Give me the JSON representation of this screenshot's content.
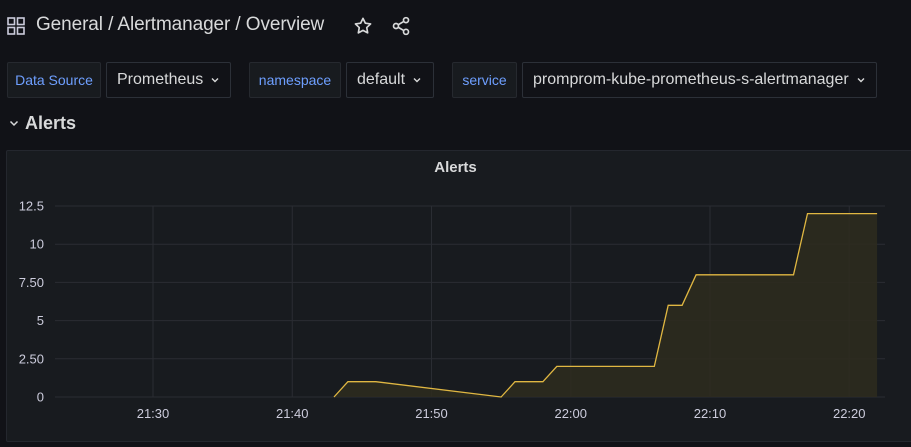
{
  "header": {
    "breadcrumb": "General  / Alertmanager / Overview"
  },
  "icons": {
    "apps": "apps-grid-icon",
    "star": "star-icon",
    "share": "share-icon",
    "chevron": "chevron-down-icon"
  },
  "variables": [
    {
      "label": "Data Source",
      "value": "Prometheus"
    },
    {
      "label": "namespace",
      "value": "default"
    },
    {
      "label": "service",
      "value": "promprom-kube-prometheus-s-alertmanager"
    }
  ],
  "row": {
    "title": "Alerts"
  },
  "panel": {
    "title": "Alerts"
  },
  "colors": {
    "background": "#111217",
    "panel": "#181b1f",
    "label": "#6e9fff",
    "series_line": "#e0b742",
    "series_fill": "#2e2b1f"
  },
  "chart_data": {
    "type": "area",
    "title": "Alerts",
    "xlabel": "",
    "ylabel": "",
    "x_ticks": [
      "21:30",
      "21:40",
      "21:50",
      "22:00",
      "22:10",
      "22:20"
    ],
    "y_ticks": [
      "0",
      "2.50",
      "5",
      "7.50",
      "10",
      "12.5"
    ],
    "ylim": [
      0,
      12.5
    ],
    "grid": true,
    "legend": "none",
    "series": [
      {
        "x": [
          "21:43",
          "21:44",
          "21:46",
          "21:55",
          "21:56",
          "21:58",
          "21:59",
          "22:06",
          "22:07",
          "22:08",
          "22:09",
          "22:16",
          "22:17",
          "22:22"
        ],
        "values": [
          0,
          1,
          1,
          0,
          1,
          1,
          2,
          2,
          6,
          6,
          8,
          8,
          12,
          12
        ]
      }
    ]
  }
}
